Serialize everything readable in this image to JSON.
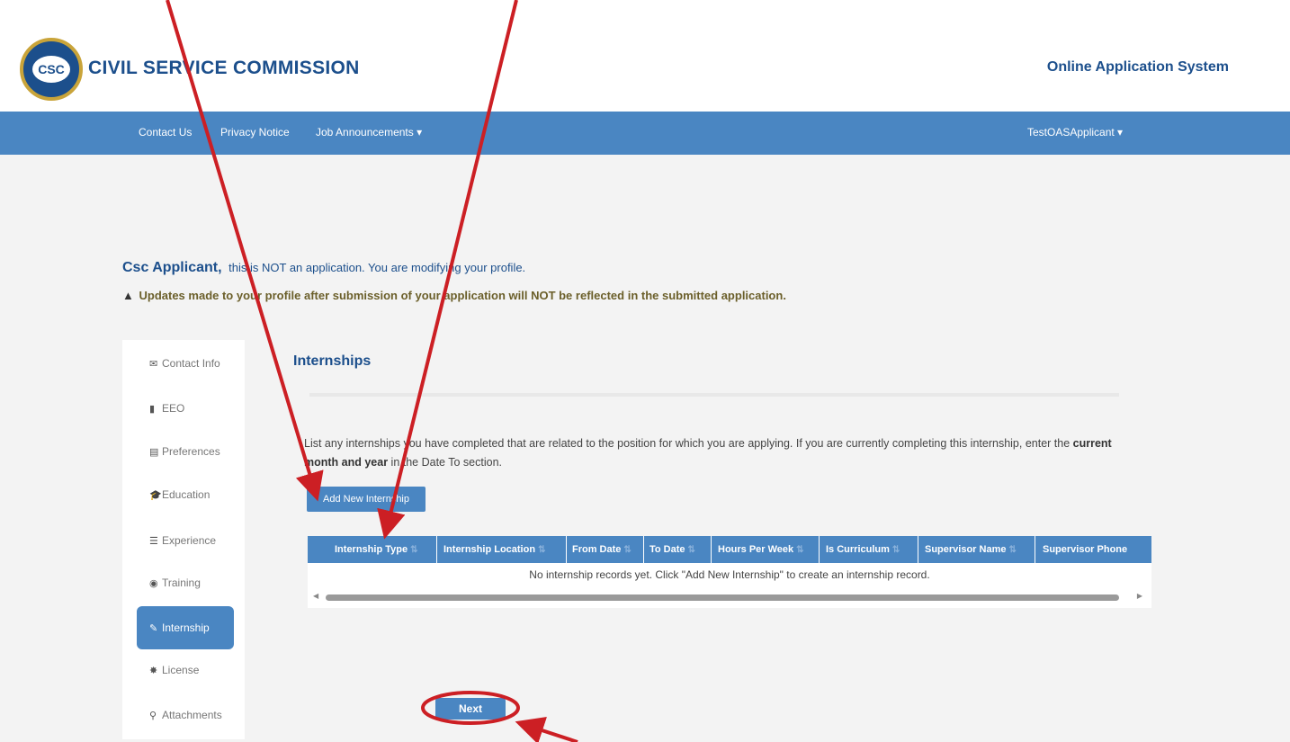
{
  "header": {
    "logo_text": "CSC",
    "brand": "CIVIL SERVICE COMMISSION",
    "system_name": "Online Application System"
  },
  "nav": {
    "items": [
      {
        "label": "Contact Us"
      },
      {
        "label": "Privacy Notice"
      },
      {
        "label": "Job Announcements ▾"
      }
    ],
    "user": "TestOASApplicant ▾"
  },
  "notice": {
    "name": "Csc Applicant,",
    "line1": "this is NOT an application.   You are modifying your profile.",
    "line2": "Updates made to your profile after submission of your application will NOT be reflected in the submitted application."
  },
  "sidebar": {
    "items": [
      {
        "label": "Contact Info",
        "icon": "envelope-icon",
        "glyph": "✉"
      },
      {
        "label": "EEO",
        "icon": "bookmark-icon",
        "glyph": "▮"
      },
      {
        "label": "Preferences",
        "icon": "list-icon",
        "glyph": "▤"
      },
      {
        "label": "Education",
        "icon": "graduation-cap-icon",
        "glyph": "🎓"
      },
      {
        "label": "Experience",
        "icon": "briefcase-icon",
        "glyph": "☰"
      },
      {
        "label": "Training",
        "icon": "eye-icon",
        "glyph": "◉"
      },
      {
        "label": "Internship",
        "icon": "wrench-icon",
        "glyph": "✎"
      },
      {
        "label": "License",
        "icon": "certificate-icon",
        "glyph": "✸"
      },
      {
        "label": "Attachments",
        "icon": "paperclip-icon",
        "glyph": "⚲"
      }
    ],
    "active": "Internship"
  },
  "content": {
    "title": "Internships",
    "intro_part1": "List any internships you have completed that are related to the position for which you are applying. If you are currently completing this internship, enter the ",
    "intro_bold": "current month and year",
    "intro_part2": " in the Date To section.",
    "add_button": "Add New Internship",
    "table": {
      "columns": [
        "Internship Type",
        "Internship Location",
        "From Date",
        "To Date",
        "Hours Per Week",
        "Is Curriculum",
        "Supervisor Name",
        "Supervisor Phone"
      ],
      "empty_message": "No internship records yet.   Click \"Add New Internship\" to create an internship record."
    },
    "next_button": "Next"
  },
  "colors": {
    "brand_blue": "#1c4f8c",
    "nav_blue": "#4a86c2",
    "annotation_red": "#cc1f24"
  }
}
